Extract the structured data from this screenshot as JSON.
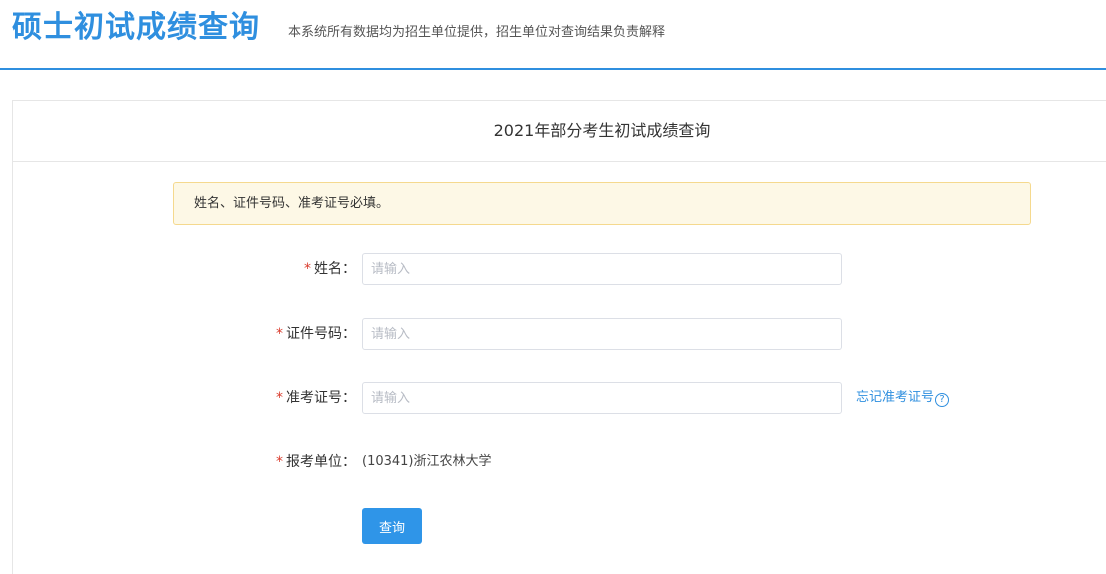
{
  "header": {
    "title": "硕士初试成绩查询",
    "subtitle": "本系统所有数据均为招生单位提供，招生单位对查询结果负责解释"
  },
  "panel": {
    "title": "2021年部分考生初试成绩查询"
  },
  "notice": {
    "text": "姓名、证件号码、准考证号必填。"
  },
  "form": {
    "required_mark": "*",
    "name": {
      "label": "姓名：",
      "placeholder": "请输入",
      "value": ""
    },
    "id_number": {
      "label": "证件号码：",
      "placeholder": "请输入",
      "value": ""
    },
    "exam_number": {
      "label": "准考证号：",
      "placeholder": "请输入",
      "value": "",
      "forgot_link": "忘记准考证号",
      "help_glyph": "?"
    },
    "unit": {
      "label": "报考单位：",
      "value": "(10341)浙江农林大学"
    },
    "submit_label": "查询"
  },
  "colors": {
    "primary": "#2f8fdf",
    "button": "#2f95e8",
    "required": "#d93a2b",
    "notice_bg": "#fdf8e6",
    "notice_border": "#f5d98e"
  }
}
